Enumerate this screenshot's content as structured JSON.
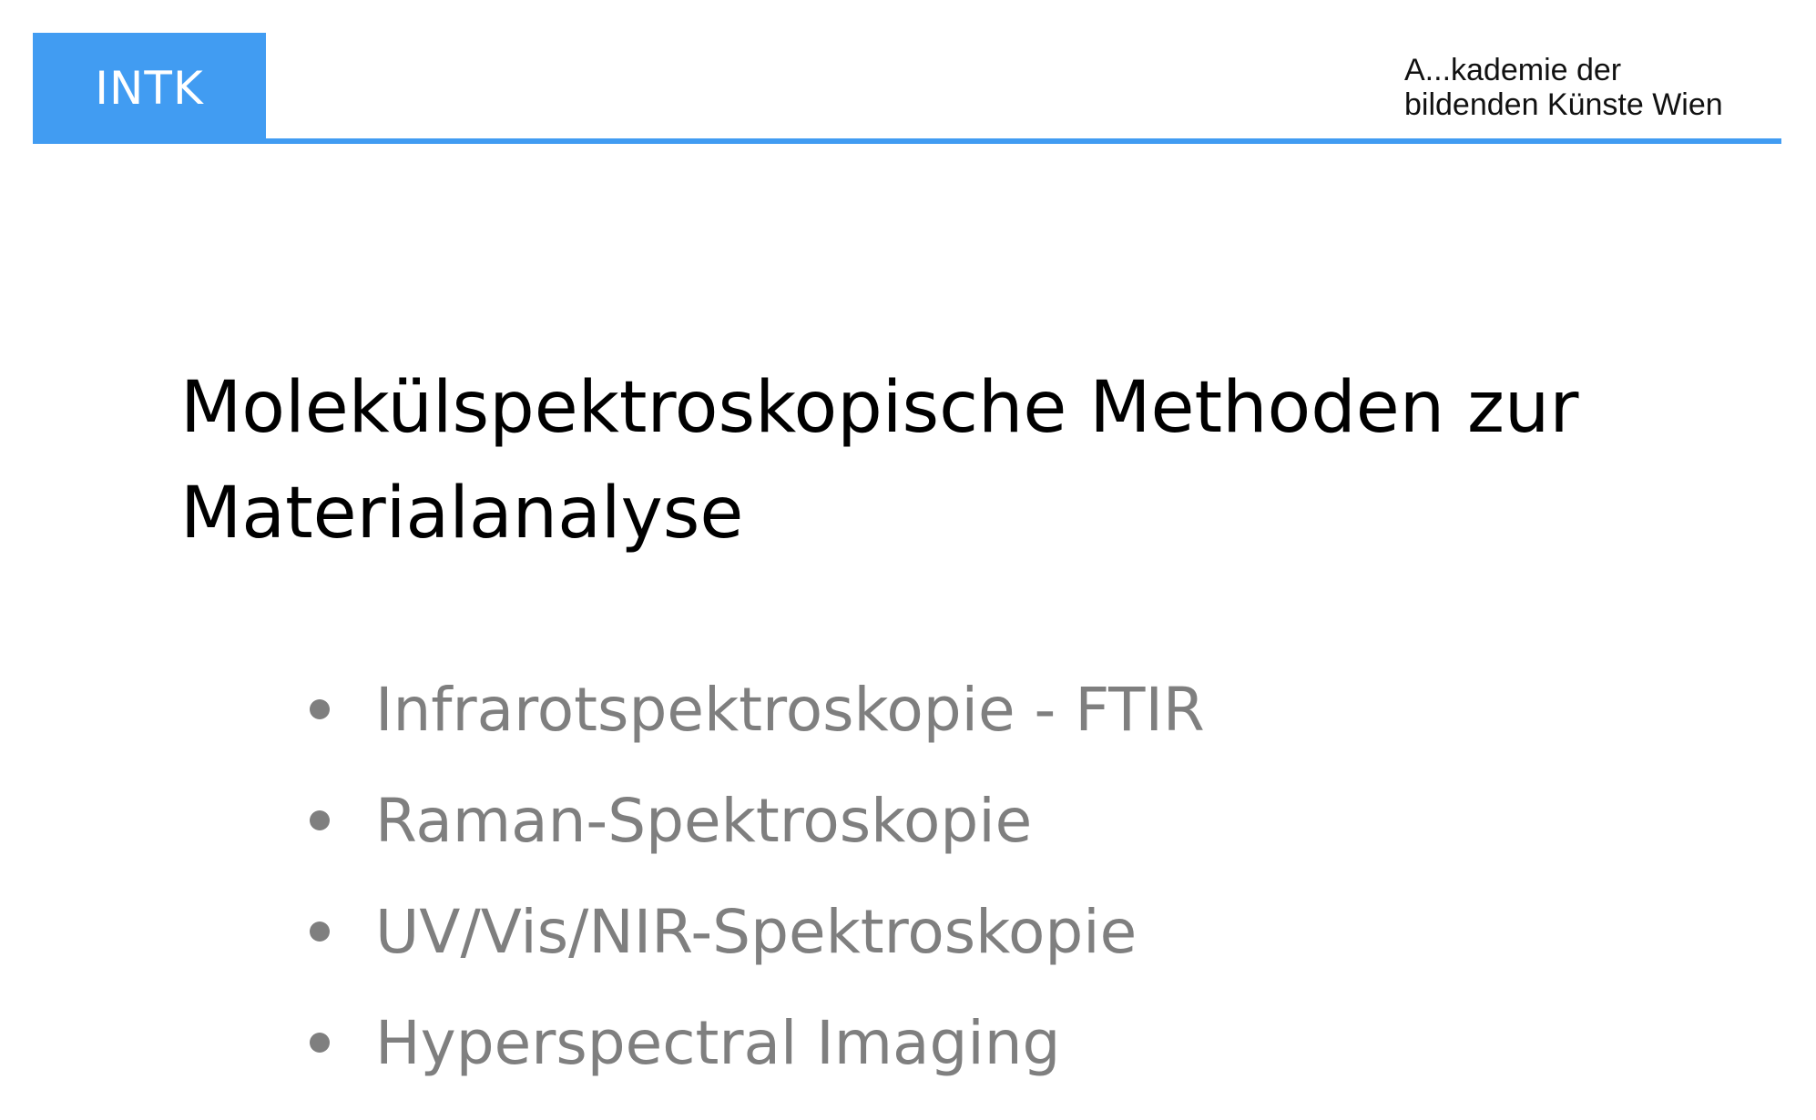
{
  "header": {
    "badge_label": "INTK",
    "institution_line1": "A...kademie der",
    "institution_line2": "bildenden Künste Wien"
  },
  "title": {
    "line1": "Molekülspektroskopische Methoden zur",
    "line2": "Materialanalyse"
  },
  "bullets": [
    "Infrarotspektroskopie - FTIR",
    "Raman-Spektroskopie",
    "UV/Vis/NIR-Spektroskopie",
    "Hyperspectral Imaging"
  ],
  "colors": {
    "accent": "#419cf2",
    "title_text": "#000000",
    "bullet_text": "#7f7f7f"
  }
}
